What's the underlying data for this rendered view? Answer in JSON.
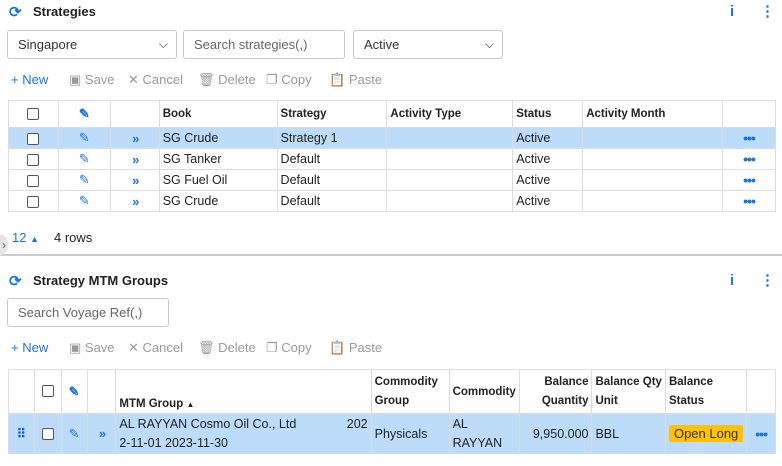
{
  "strategies": {
    "title": "Strategies",
    "region_filter": "Singapore",
    "search_placeholder": "Search strategies(,)",
    "status_filter": "Active",
    "toolbar": {
      "new": "+ New",
      "save": "Save",
      "cancel": "Cancel",
      "delete": "Delete",
      "copy": "Copy",
      "paste": "Paste"
    },
    "columns": [
      "Book",
      "Strategy",
      "Activity Type",
      "Status",
      "Activity Month"
    ],
    "rows": [
      {
        "book": "SG Crude",
        "strategy": "Strategy 1",
        "activity_type": "",
        "status": "Active",
        "activity_month": ""
      },
      {
        "book": "SG Tanker",
        "strategy": "Default",
        "activity_type": "",
        "status": "Active",
        "activity_month": ""
      },
      {
        "book": "SG Fuel Oil",
        "strategy": "Default",
        "activity_type": "",
        "status": "Active",
        "activity_month": ""
      },
      {
        "book": "SG Crude",
        "strategy": "Default",
        "activity_type": "",
        "status": "Active",
        "activity_month": ""
      }
    ],
    "page_size": "12",
    "row_count": "4 rows"
  },
  "mtm": {
    "title": "Strategy MTM Groups",
    "search_placeholder": "Search Voyage Ref(,)",
    "toolbar": {
      "new": "+ New",
      "save": "Save",
      "cancel": "Cancel",
      "delete": "Delete",
      "copy": "Copy",
      "paste": "Paste"
    },
    "columns": {
      "mtm_group": "MTM Group",
      "commodity_group_1": "Commodity",
      "commodity_group_2": "Group",
      "commodity": "Commodity",
      "balance_qty_1": "Balance",
      "balance_qty_2": "Quantity",
      "balance_unit_1": "Balance Qty",
      "balance_unit_2": "Unit",
      "balance_status_1": "Balance",
      "balance_status_2": "Status"
    },
    "row": {
      "mtm_group_line1": "AL RAYYAN Cosmo Oil Co., Ltd",
      "mtm_group_line1_tail": "202",
      "mtm_group_line2": "2-11-01 2023-11-30",
      "commodity_group": "Physicals",
      "commodity_line1": "AL",
      "commodity_line2": "RAYYAN",
      "balance_quantity": "9,950.000",
      "unit": "BBL",
      "status": "Open Long"
    }
  }
}
